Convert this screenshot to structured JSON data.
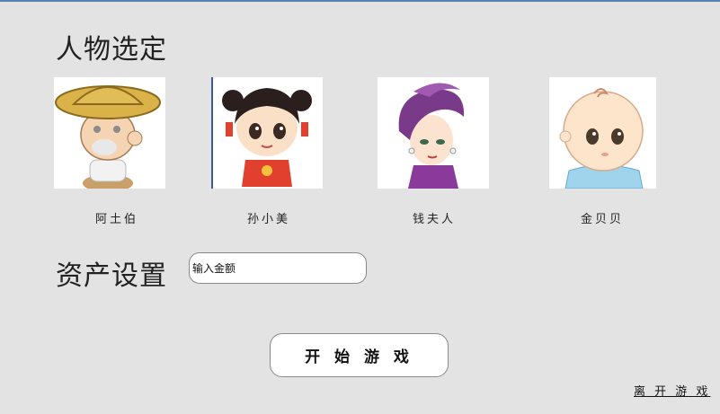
{
  "character_section": {
    "title": "人物选定"
  },
  "characters": [
    {
      "name": "阿土伯",
      "icon": "old-farmer-avatar"
    },
    {
      "name": "孙小美",
      "icon": "girl-avatar"
    },
    {
      "name": "钱夫人",
      "icon": "lady-avatar"
    },
    {
      "name": "金贝贝",
      "icon": "baby-avatar"
    }
  ],
  "asset_section": {
    "title": "资产设置"
  },
  "money_input": {
    "value": "输入金额"
  },
  "start_button": {
    "label": "开 始 游 戏"
  },
  "exit_link": {
    "label": "离 开 游 戏"
  }
}
